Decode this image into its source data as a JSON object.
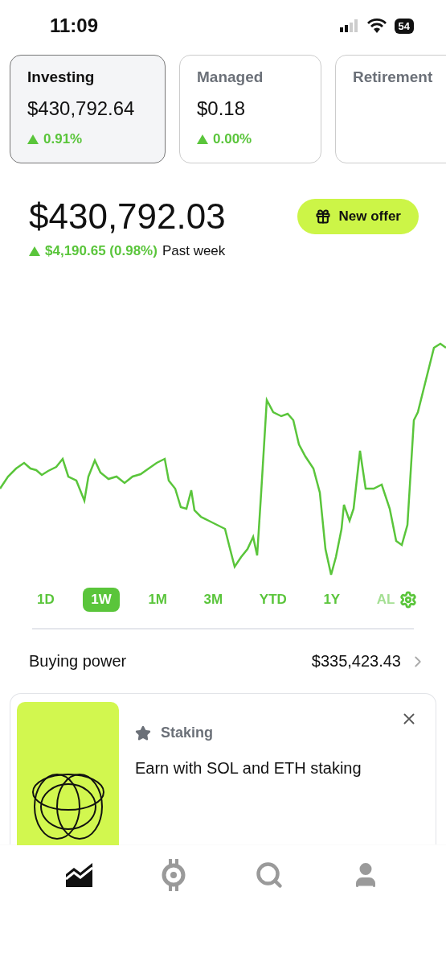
{
  "status_bar": {
    "time": "11:09",
    "battery": "54"
  },
  "accounts": [
    {
      "name": "Investing",
      "value": "$430,792.64",
      "change": "0.91%",
      "selected": true
    },
    {
      "name": "Managed",
      "value": "$0.18",
      "change": "0.00%",
      "selected": false
    },
    {
      "name": "Retirement",
      "selected": false
    }
  ],
  "portfolio": {
    "value": "$430,792.03",
    "change": "$4,190.65 (0.98%)",
    "period": "Past week",
    "offer_button": "New offer"
  },
  "ranges": [
    {
      "label": "1D",
      "selected": false
    },
    {
      "label": "1W",
      "selected": true
    },
    {
      "label": "1M",
      "selected": false
    },
    {
      "label": "3M",
      "selected": false
    },
    {
      "label": "YTD",
      "selected": false
    },
    {
      "label": "1Y",
      "selected": false
    },
    {
      "label": "AL",
      "selected": false
    }
  ],
  "buying_power": {
    "label": "Buying power",
    "value": "$335,423.43"
  },
  "promo": {
    "tag": "Staking",
    "title": "Earn with SOL and ETH staking"
  },
  "nav": [
    {
      "kind": "chart",
      "selected": true
    },
    {
      "kind": "crypto",
      "selected": false
    },
    {
      "kind": "search",
      "selected": false
    },
    {
      "kind": "profile",
      "selected": false
    }
  ]
}
